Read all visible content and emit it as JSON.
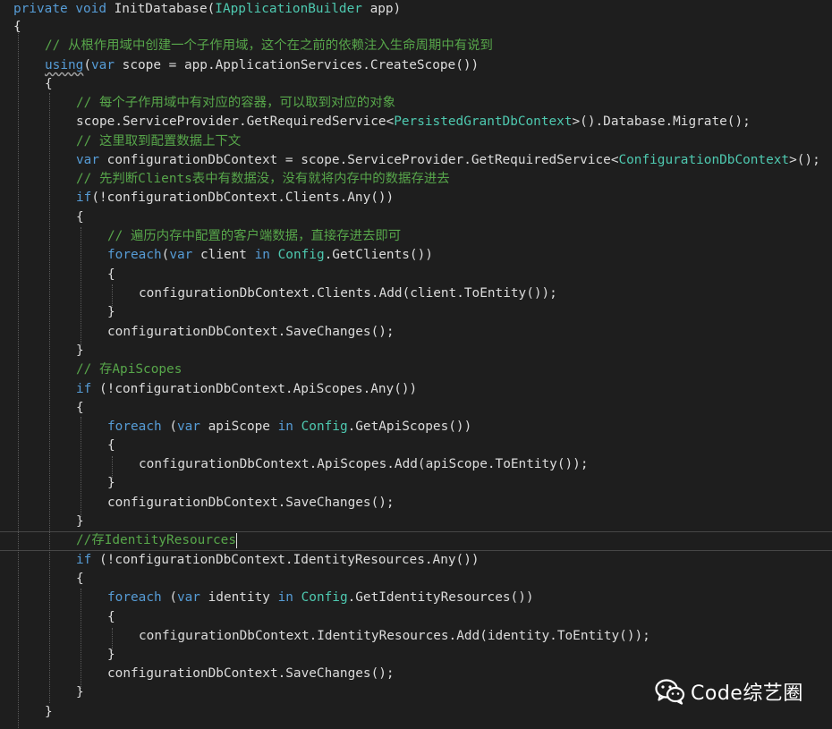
{
  "watermark": {
    "icon": "wechat-icon",
    "text": "Code综艺圈"
  },
  "code_lines": [
    {
      "text": "private void InitDatabase(IApplicationBuilder app)"
    },
    {
      "text": "{"
    },
    {
      "text": "// 从根作用域中创建一个子作用域，这个在之前的依赖注入生命周期中有说到"
    },
    {
      "text": "using(var scope = app.ApplicationServices.CreateScope())"
    },
    {
      "text": "{"
    },
    {
      "text": "// 每个子作用域中有对应的容器，可以取到对应的对象"
    },
    {
      "text": "scope.ServiceProvider.GetRequiredService<PersistedGrantDbContext>().Database.Migrate();"
    },
    {
      "text": "// 这里取到配置数据上下文"
    },
    {
      "text": "var configurationDbContext = scope.ServiceProvider.GetRequiredService<ConfigurationDbContext>();"
    },
    {
      "text": "// 先判断Clients表中有数据没，没有就将内存中的数据存进去"
    },
    {
      "text": "if(!configurationDbContext.Clients.Any())"
    },
    {
      "text": "{"
    },
    {
      "text": "// 遍历内存中配置的客户端数据，直接存进去即可"
    },
    {
      "text": "foreach(var client in Config.GetClients())"
    },
    {
      "text": "{"
    },
    {
      "text": "configurationDbContext.Clients.Add(client.ToEntity());"
    },
    {
      "text": "}"
    },
    {
      "text": "configurationDbContext.SaveChanges();"
    },
    {
      "text": "}"
    },
    {
      "text": "// 存ApiScopes"
    },
    {
      "text": "if (!configurationDbContext.ApiScopes.Any())"
    },
    {
      "text": "{"
    },
    {
      "text": "foreach (var apiScope in Config.GetApiScopes())"
    },
    {
      "text": "{"
    },
    {
      "text": "configurationDbContext.ApiScopes.Add(apiScope.ToEntity());"
    },
    {
      "text": "}"
    },
    {
      "text": "configurationDbContext.SaveChanges();"
    },
    {
      "text": "}"
    },
    {
      "text": "//存IdentityResources"
    },
    {
      "text": "if (!configurationDbContext.IdentityResources.Any())"
    },
    {
      "text": "{"
    },
    {
      "text": "foreach (var identity in Config.GetIdentityResources())"
    },
    {
      "text": "{"
    },
    {
      "text": "configurationDbContext.IdentityResources.Add(identity.ToEntity());"
    },
    {
      "text": "}"
    },
    {
      "text": "configurationDbContext.SaveChanges();"
    },
    {
      "text": "}"
    },
    {
      "text": "}"
    }
  ]
}
